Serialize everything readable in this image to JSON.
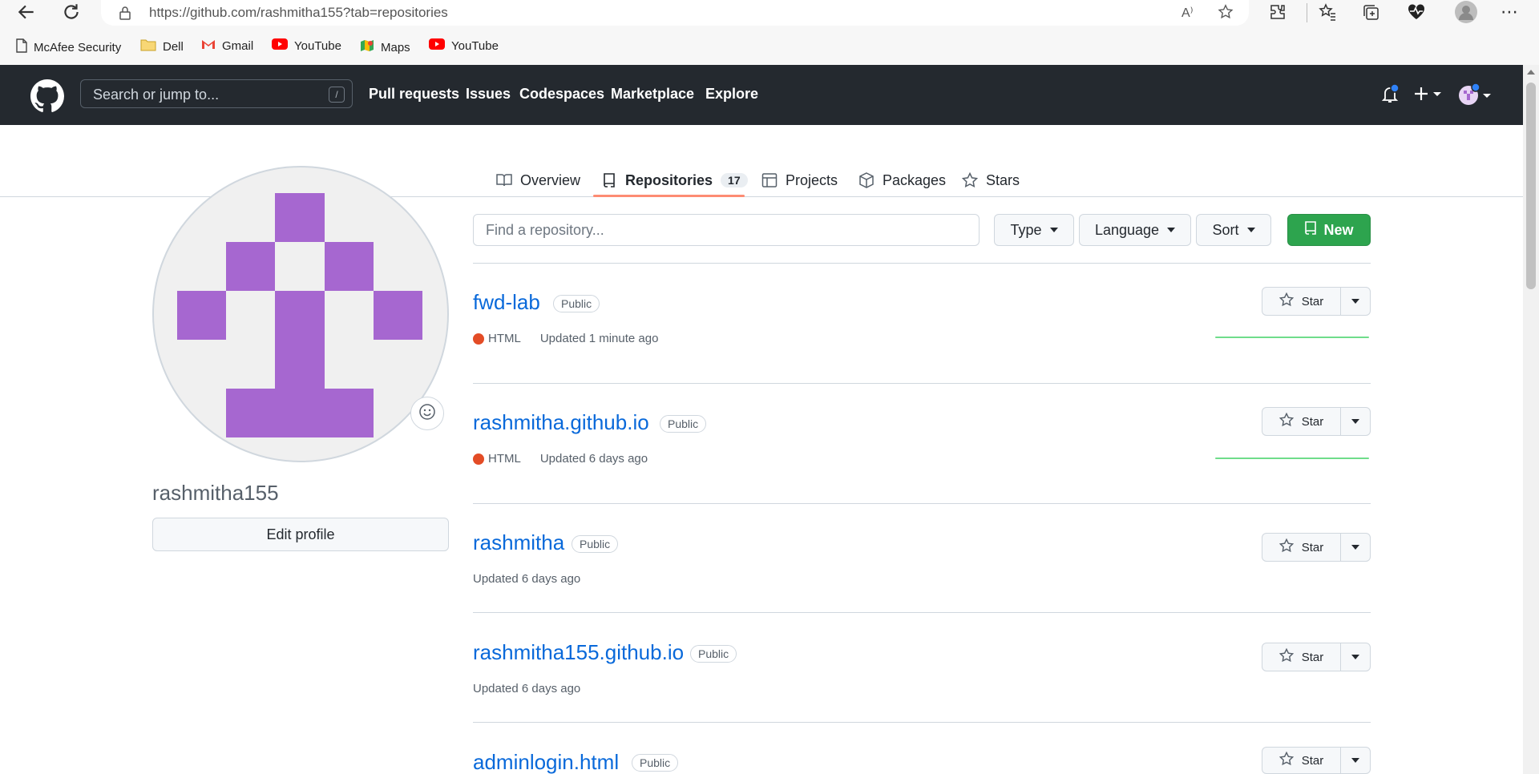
{
  "browser": {
    "url": "https://github.com/rashmitha155?tab=repositories",
    "bookmarks": [
      {
        "label": "McAfee Security",
        "icon": "document-icon"
      },
      {
        "label": "Dell",
        "icon": "folder-icon"
      },
      {
        "label": "Gmail",
        "icon": "gmail-icon"
      },
      {
        "label": "YouTube",
        "icon": "youtube-icon"
      },
      {
        "label": "Maps",
        "icon": "maps-icon"
      },
      {
        "label": "YouTube",
        "icon": "youtube-icon"
      }
    ]
  },
  "header": {
    "search_placeholder": "Search or jump to...",
    "search_shortcut": "/",
    "nav": [
      "Pull requests",
      "Issues",
      "Codespaces",
      "Marketplace",
      "Explore"
    ]
  },
  "tabs": [
    {
      "label": "Overview",
      "icon": "book-icon"
    },
    {
      "label": "Repositories",
      "icon": "repo-icon",
      "count": "17",
      "selected": true
    },
    {
      "label": "Projects",
      "icon": "table-icon"
    },
    {
      "label": "Packages",
      "icon": "package-icon"
    },
    {
      "label": "Stars",
      "icon": "star-icon"
    }
  ],
  "profile": {
    "username": "rashmitha155",
    "edit_label": "Edit profile",
    "avatar_color": "#a667d0"
  },
  "filters": {
    "find_placeholder": "Find a repository...",
    "type_label": "Type",
    "language_label": "Language",
    "sort_label": "Sort",
    "new_label": "New"
  },
  "repos": [
    {
      "name": "fwd-lab",
      "visibility": "Public",
      "language": "HTML",
      "updated": "Updated 1 minute ago",
      "star_label": "Star"
    },
    {
      "name": "rashmitha.github.io",
      "visibility": "Public",
      "language": "HTML",
      "updated": "Updated 6 days ago",
      "star_label": "Star"
    },
    {
      "name": "rashmitha",
      "visibility": "Public",
      "language": "",
      "updated": "Updated 6 days ago",
      "star_label": "Star"
    },
    {
      "name": "rashmitha155.github.io",
      "visibility": "Public",
      "language": "",
      "updated": "Updated 6 days ago",
      "star_label": "Star"
    },
    {
      "name": "adminlogin.html",
      "visibility": "Public",
      "language": "",
      "updated": "",
      "star_label": "Star"
    }
  ],
  "colors": {
    "header_bg": "#24292f",
    "link": "#0969da",
    "new_button": "#2da44e",
    "html_lang": "#e34c26",
    "tab_underline": "#fd8c73"
  }
}
